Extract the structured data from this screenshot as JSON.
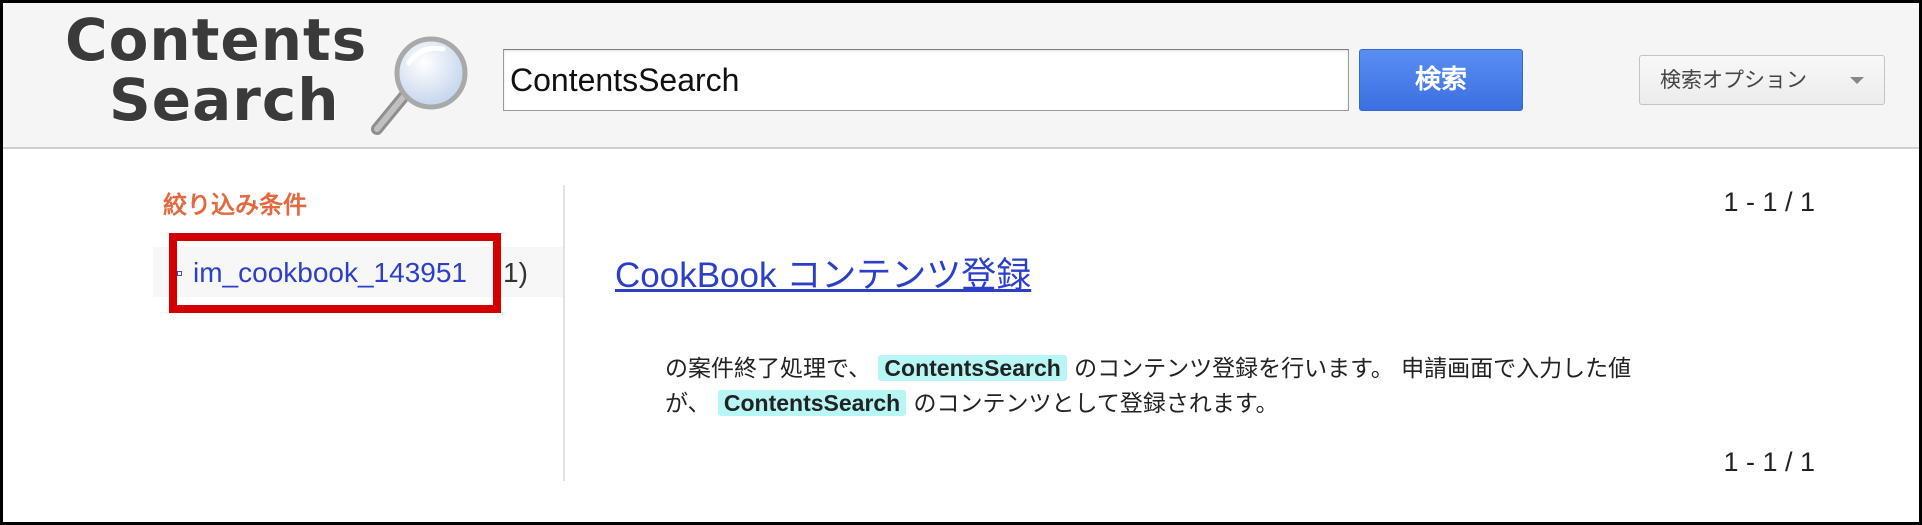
{
  "header": {
    "logo": {
      "line1": "Contents",
      "line2": "Search"
    },
    "search": {
      "value": "ContentsSearch"
    },
    "search_button_label": "検索",
    "options_button_label": "検索オプション"
  },
  "sidebar": {
    "title": "絞り込み条件",
    "facets": [
      {
        "label": "im_cookbook_143951",
        "count": "1)"
      }
    ]
  },
  "results": {
    "pager_top": "1 - 1 / 1",
    "pager_bottom": "1 - 1 / 1",
    "items": [
      {
        "title": "CookBook コンテンツ登録",
        "snippet": {
          "part1": "の案件終了処理で、",
          "hl1": "ContentsSearch",
          "part2": "のコンテンツ登録を行います。 申請画面で入力した値",
          "part3": "が、",
          "hl2": "ContentsSearch",
          "part4": "のコンテンツとして登録されます。"
        }
      }
    ]
  },
  "colors": {
    "accent_orange": "#e26a3e",
    "link_blue": "#2c3fc8",
    "button_blue": "#4a7ee8",
    "highlight_cyan": "#b8f5f5",
    "annotation_red": "#d40000"
  }
}
